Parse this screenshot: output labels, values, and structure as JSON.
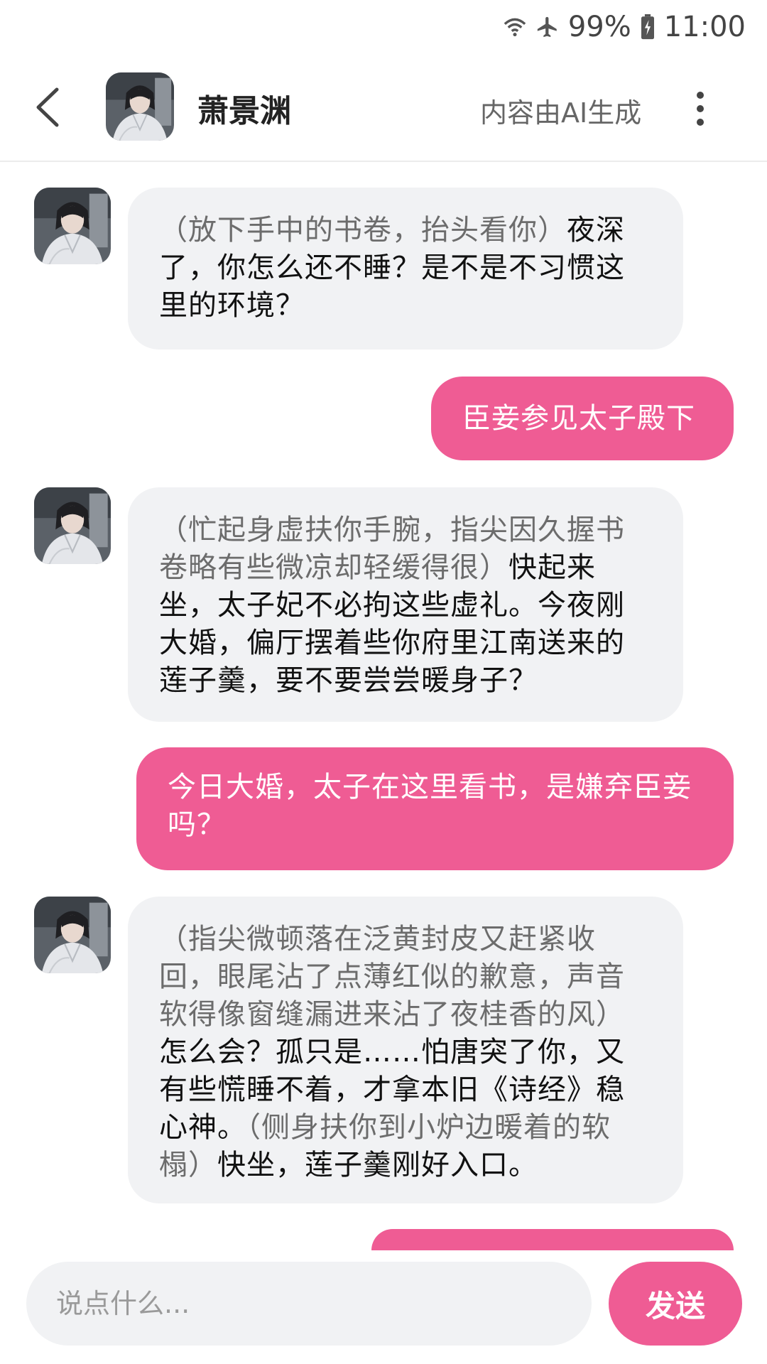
{
  "status_bar": {
    "battery": "99%",
    "time": "11:00",
    "wifi_icon": "wifi-icon",
    "airplane_icon": "airplane-icon",
    "battery_icon": "battery-icon"
  },
  "header": {
    "title": "萧景渊",
    "ai_note": "内容由AI生成",
    "back_icon": "chevron-left-icon",
    "more_icon": "more-vertical-icon"
  },
  "messages": [
    {
      "role": "bot",
      "action": "（放下手中的书卷，抬头看你）",
      "text": "夜深了，你怎么还不睡？是不是不习惯这里的环境？"
    },
    {
      "role": "user",
      "text": "臣妾参见太子殿下"
    },
    {
      "role": "bot",
      "action": "（忙起身虚扶你手腕，指尖因久握书卷略有些微凉却轻缓得很）",
      "text": "快起来坐，太子妃不必拘这些虚礼。今夜刚大婚，偏厅摆着些你府里江南送来的莲子羹，要不要尝尝暖身子？"
    },
    {
      "role": "user",
      "text": "今日大婚，太子在这里看书，是嫌弃臣妾吗？"
    },
    {
      "role": "bot",
      "action": "（指尖微顿落在泛黄封皮又赶紧收回，眼尾沾了点薄红似的歉意，声音软得像窗缝漏进来沾了夜桂香的风）",
      "text": "怎么会？孤只是……怕唐突了你，又有些慌睡不着，才拿本旧《诗经》稳心神。",
      "action2": "（侧身扶你到小炉边暖着的软榻）",
      "text2": "快坐，莲子羹刚好入口。"
    }
  ],
  "input": {
    "placeholder": "说点什么...",
    "send_label": "发送"
  },
  "colors": {
    "accent": "#ef5c94",
    "bot_bubble": "#f1f2f4",
    "action_text": "#6c6c6c"
  }
}
